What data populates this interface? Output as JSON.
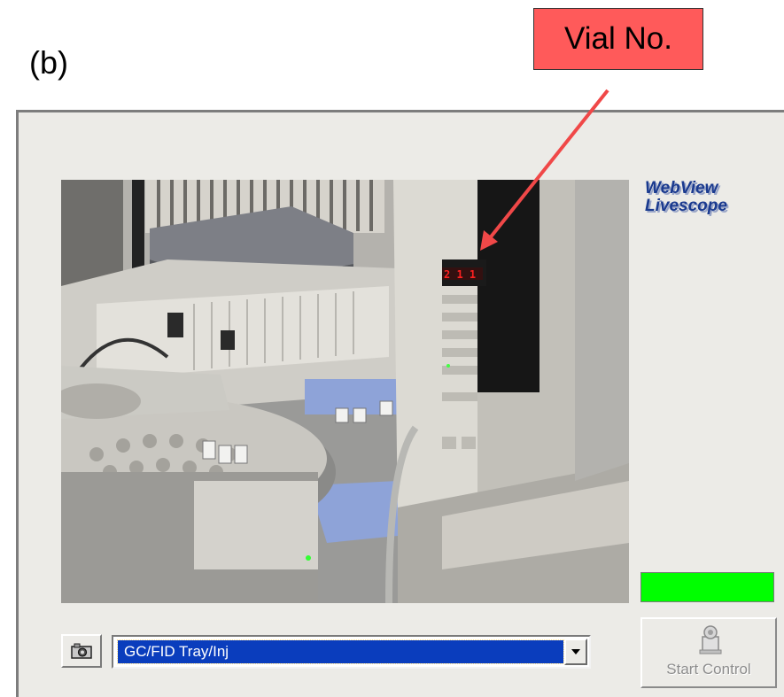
{
  "figure_label": "(b)",
  "callout": {
    "text": "Vial No.",
    "color": "#ff5a5a"
  },
  "logo": {
    "line1": "WebView",
    "line2": "Livescope"
  },
  "video": {
    "led_display": "2 1 1",
    "led_color": "#ff2020"
  },
  "status_indicator": {
    "color": "#00ff00"
  },
  "camera_select": {
    "value": "GC/FID Tray/Inj"
  },
  "start_control": {
    "label": "Start Control"
  },
  "icons": {
    "snapshot": "camera-icon",
    "dropdown": "chevron-down-icon",
    "control": "control-panel-icon"
  }
}
